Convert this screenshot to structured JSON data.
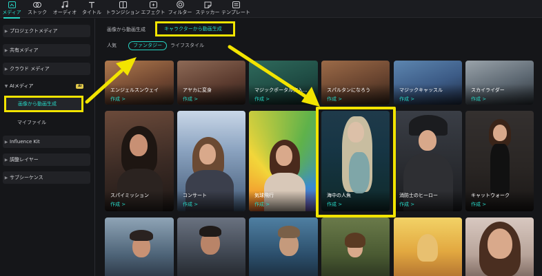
{
  "toolbar": {
    "items": [
      {
        "label": "メディア",
        "icon": "media-icon",
        "active": true
      },
      {
        "label": "ストック",
        "icon": "stock-icon"
      },
      {
        "label": "オーディオ",
        "icon": "music-note-icon"
      },
      {
        "label": "タイトル",
        "icon": "title-t-icon"
      },
      {
        "label": "トランジション",
        "icon": "transition-icon"
      },
      {
        "label": "エフェクト",
        "icon": "effect-icon"
      },
      {
        "label": "フィルター",
        "icon": "filter-icon"
      },
      {
        "label": "ステッカー",
        "icon": "sticker-icon"
      },
      {
        "label": "テンプレート",
        "icon": "template-icon"
      }
    ]
  },
  "sidebar": {
    "items": [
      {
        "label": "プロジェクトメディア"
      },
      {
        "label": "共有メディア"
      },
      {
        "label": "クラウド メディア"
      },
      {
        "label": "AIメディア",
        "badge": "AI"
      },
      {
        "label": "画像から動画生成"
      },
      {
        "label": "マイファイル"
      },
      {
        "label": "Influence Kit"
      },
      {
        "label": "調整レイヤー"
      },
      {
        "label": "サブシーケンス"
      }
    ]
  },
  "main": {
    "breadcrumb": "画像から動画生成",
    "breadcrumb_active": "キャラクターから動画生成",
    "tabs": [
      {
        "label": "人気"
      },
      {
        "label": "ファンタジー",
        "active": true
      },
      {
        "label": "ライフスタイル"
      }
    ],
    "action_label": "作成 >",
    "cards_row1": [
      "エンジェルスンウェイ",
      "アヤカに変身",
      "マジックポータル突入...",
      "スパルタンになろう",
      "マジックキャッスル",
      "スカイライダー"
    ],
    "cards_row2": [
      "スパイミッション",
      "コンサート",
      "気球飛行",
      "海中の人魚",
      "消防士のヒーロー",
      "キャットウォーク"
    ]
  },
  "colors": {
    "accent": "#27d7c6",
    "highlight": "#f2e400",
    "background": "#151619",
    "panel": "#212226"
  }
}
